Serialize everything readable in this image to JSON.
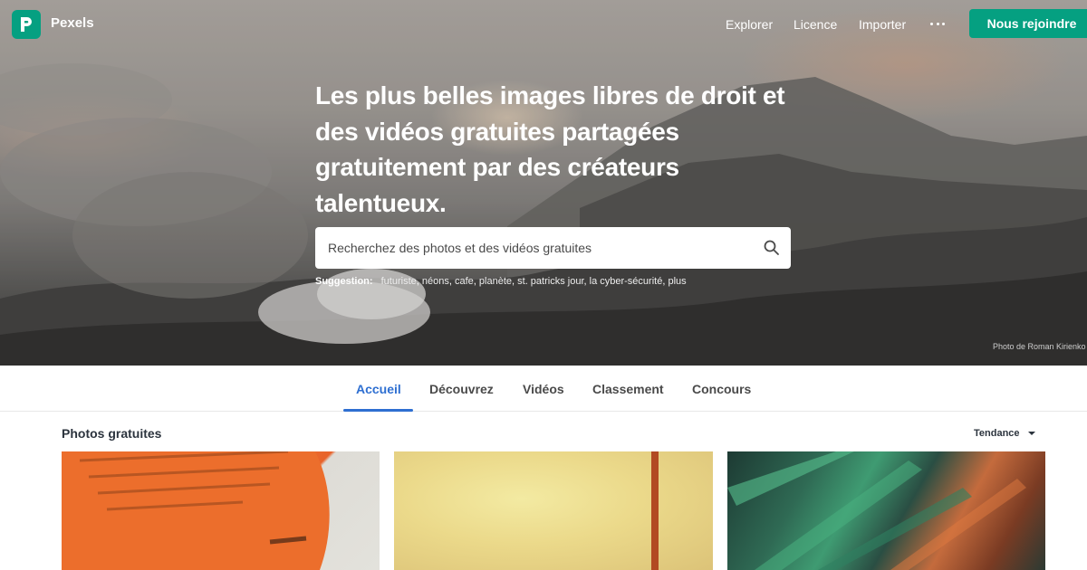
{
  "brand": {
    "name": "Pexels",
    "logo_icon": "pexels-logo-icon",
    "accent": "#05a081"
  },
  "nav": {
    "links": [
      "Explorer",
      "Licence",
      "Importer"
    ],
    "more_icon": "ellipsis-icon",
    "join_label": "Nous rejoindre"
  },
  "hero": {
    "headline": "Les plus belles images libres de droit et des vidéos gratuites partagées gratuitement par des créateurs talentueux.",
    "search_placeholder": "Recherchez des photos et des vidéos gratuites",
    "search_icon": "search-icon",
    "suggestion_label": "Suggestion:",
    "suggestions": [
      "futuriste",
      "néons",
      "cafe",
      "planète",
      "st. patricks jour",
      "la cyber-sécurité",
      "plus"
    ],
    "credit": "Photo de Roman Kirienko"
  },
  "tabs": {
    "items": [
      "Accueil",
      "Découvrez",
      "Vidéos",
      "Classement",
      "Concours"
    ],
    "active_index": 0,
    "active_color": "#2e6fd1"
  },
  "section": {
    "title": "Photos gratuites",
    "sort_label": "Tendance",
    "sort_icon": "caret-down-icon"
  },
  "photos": [
    "photo-orange-shirt",
    "photo-yellow-pole",
    "photo-green-orange-abstract"
  ]
}
